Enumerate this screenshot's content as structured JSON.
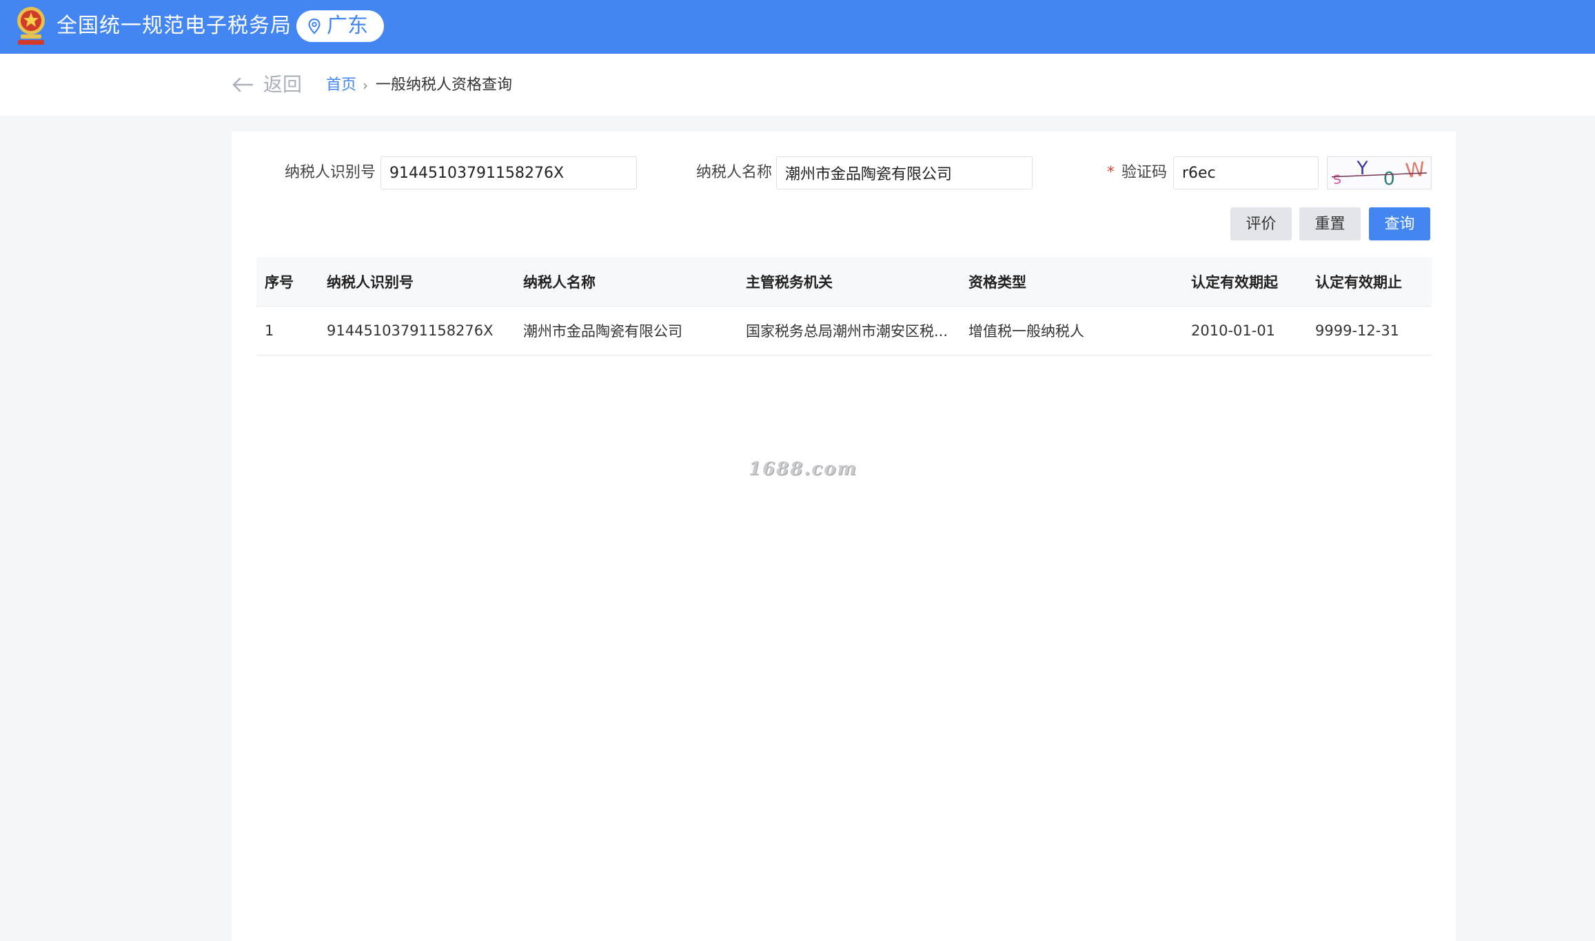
{
  "header": {
    "site_title": "全国统一规范电子税务局",
    "region": "广东",
    "brand_color": "#4386f2"
  },
  "breadcrumb": {
    "back_label": "返回",
    "home": "首页",
    "separator": "›",
    "current": "一般纳税人资格查询"
  },
  "form": {
    "taxpayer_id_label": "纳税人识别号",
    "taxpayer_id_value": "91445103791158276X",
    "taxpayer_name_label": "纳税人名称",
    "taxpayer_name_value": "潮州市金品陶瓷有限公司",
    "captcha_required": "*",
    "captcha_label": "验证码",
    "captcha_value": "r6ec",
    "captcha_image_text": "sY0W"
  },
  "buttons": {
    "evaluate": "评价",
    "reset": "重置",
    "query": "查询"
  },
  "table": {
    "columns": [
      "序号",
      "纳税人识别号",
      "纳税人名称",
      "主管税务机关",
      "资格类型",
      "认定有效期起",
      "认定有效期止"
    ],
    "rows": [
      [
        "1",
        "91445103791158276X",
        "潮州市金品陶瓷有限公司",
        "国家税务总局潮州市潮安区税...",
        "增值税一般纳税人",
        "2010-01-01",
        "9999-12-31"
      ]
    ]
  },
  "watermark": "1688.com"
}
